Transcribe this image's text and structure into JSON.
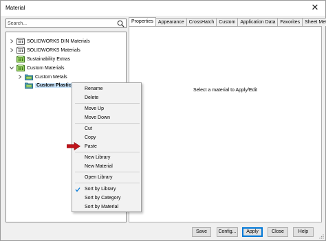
{
  "window": {
    "title": "Material",
    "close_icon": "close-icon"
  },
  "search": {
    "placeholder": "Search..."
  },
  "tree": {
    "items": [
      {
        "label": "SOLIDWORKS DIN Materials",
        "expanded": false
      },
      {
        "label": "SOLIDWORKS Materials",
        "expanded": false
      },
      {
        "label": "Sustainability Extras",
        "expanded": false
      },
      {
        "label": "Custom Materials",
        "expanded": true
      },
      {
        "label": "Custom Metals",
        "expanded": false
      },
      {
        "label": "Custom Plastics",
        "selected": true
      }
    ]
  },
  "tabs": [
    {
      "label": "Properties",
      "active": true
    },
    {
      "label": "Appearance"
    },
    {
      "label": "CrossHatch"
    },
    {
      "label": "Custom"
    },
    {
      "label": "Application Data"
    },
    {
      "label": "Favorites"
    },
    {
      "label": "Sheet Metal"
    }
  ],
  "content": {
    "message": "Select a material to Apply/Edit"
  },
  "buttons": {
    "save": "Save",
    "config": "Config...",
    "apply": "Apply",
    "close": "Close",
    "help": "Help"
  },
  "context_menu": {
    "items": [
      "Rename",
      "Delete",
      "Move Up",
      "Move Down",
      "Cut",
      "Copy",
      "Paste",
      "New Library",
      "New Material",
      "Open Library",
      "Sort by Library",
      "Sort by Category",
      "Sort by Material"
    ],
    "checked": "Sort by Library"
  },
  "colors": {
    "accent": "#0078d7",
    "folder_green": "#5a9a2e",
    "arrow_red": "#c0141b"
  }
}
